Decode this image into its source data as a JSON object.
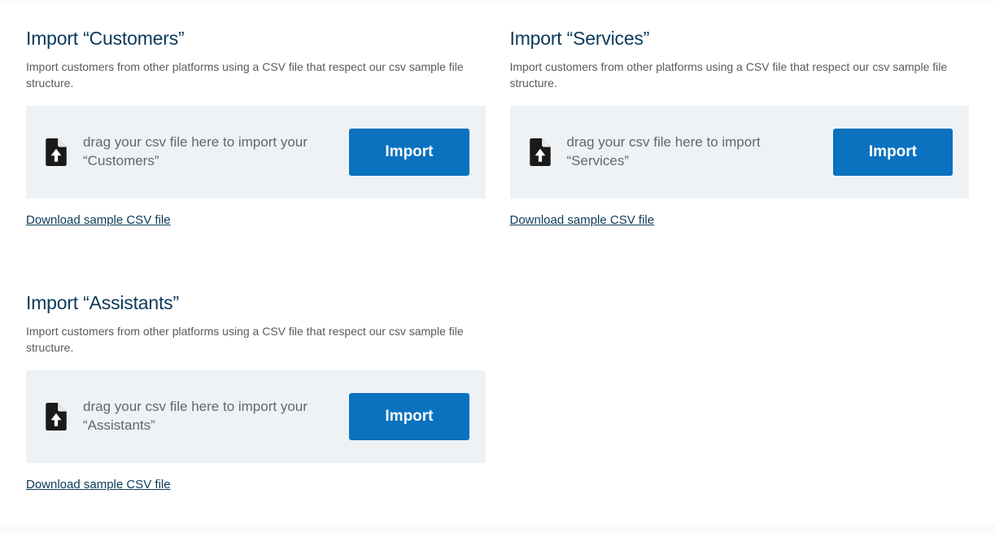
{
  "cards": [
    {
      "title": "Import “Customers”",
      "desc": "Import customers from other platforms using a CSV file that respect our csv sample file structure.",
      "drop_text": "drag your csv file here to import your “Customers”",
      "button_label": "Import",
      "download_label": "Download sample CSV file"
    },
    {
      "title": "Import “Services”",
      "desc": "Import customers from other platforms using a CSV file that respect our csv sample file structure.",
      "drop_text": "drag your csv file here to import “Services”",
      "button_label": "Import",
      "download_label": "Download sample CSV file"
    },
    {
      "title": "Import “Assistants”",
      "desc": "Import customers from other platforms using a CSV file that respect our csv sample file structure.",
      "drop_text": "drag your csv file here to import your “Assistants”",
      "button_label": "Import",
      "download_label": "Download sample CSV file"
    }
  ]
}
